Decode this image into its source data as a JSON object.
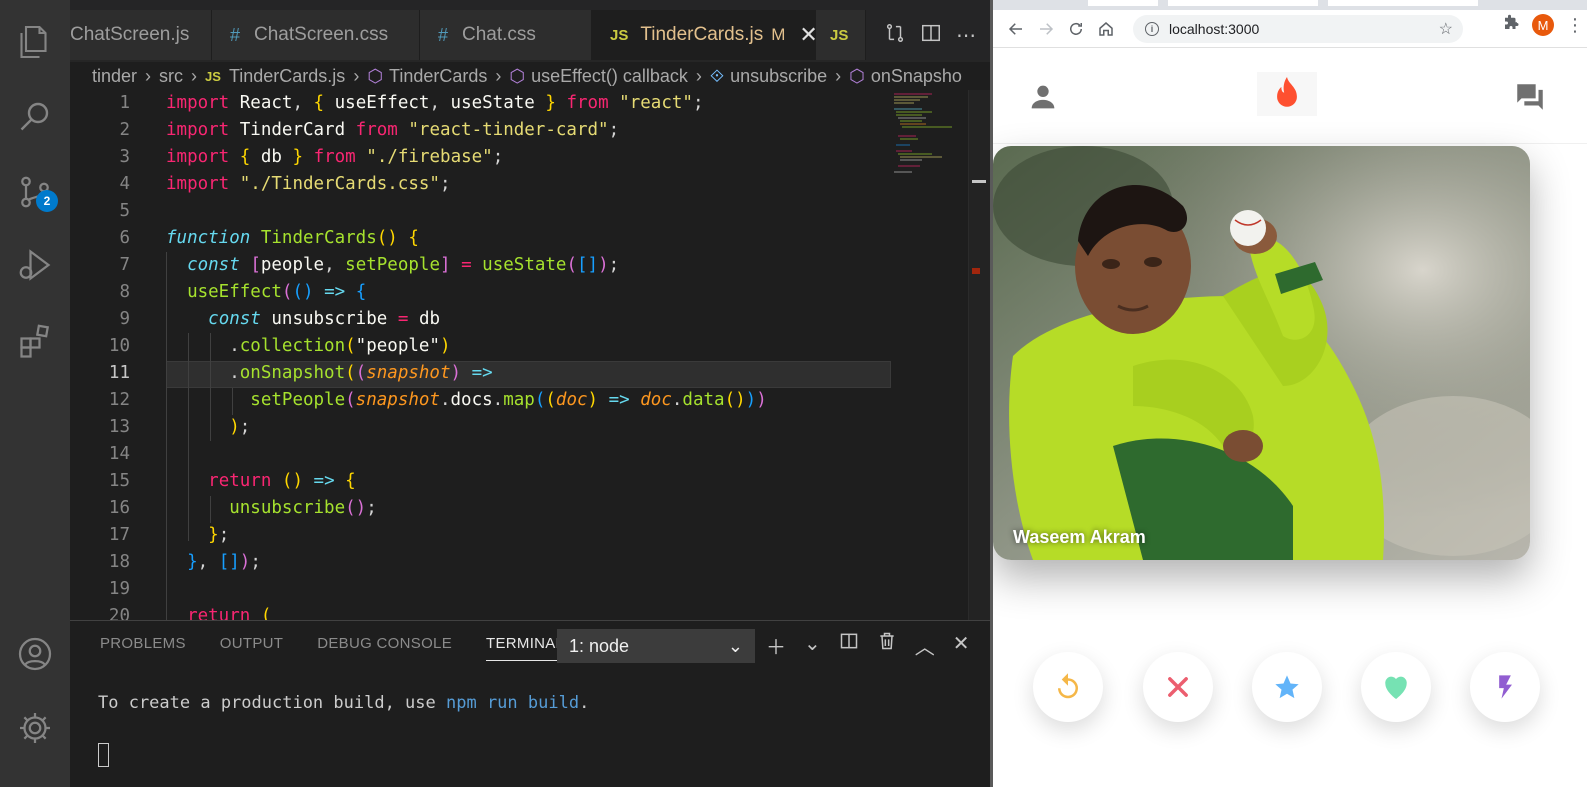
{
  "editor": {
    "tabs": [
      {
        "label": "ChatScreen.js",
        "type": "js"
      },
      {
        "label": "ChatScreen.css",
        "type": "css"
      },
      {
        "label": "Chat.css",
        "type": "css"
      },
      {
        "label": "TinderCards.js",
        "type": "js",
        "modified": "M"
      },
      {
        "label": "JS",
        "type": "js-icon"
      }
    ],
    "source_control_badge": "2",
    "breadcrumb": [
      "tinder",
      "src",
      "TinderCards.js",
      "TinderCards",
      "useEffect() callback",
      "unsubscribe",
      "onSnapsho"
    ],
    "line_numbers": [
      "1",
      "2",
      "3",
      "4",
      "5",
      "6",
      "7",
      "8",
      "9",
      "10",
      "11",
      "12",
      "13",
      "14",
      "15",
      "16",
      "17",
      "18",
      "19",
      "20"
    ],
    "current_line": "11"
  },
  "panel": {
    "tabs": [
      "PROBLEMS",
      "OUTPUT",
      "DEBUG CONSOLE",
      "TERMINAL"
    ],
    "active_tab": "TERMINAL",
    "terminal_select": "1: node",
    "terminal_line_prefix": "To create a production build, use ",
    "terminal_command": "npm run build",
    "terminal_line_suffix": "."
  },
  "browser": {
    "url": "localhost:3000",
    "profile_initial": "M",
    "card_name": "Waseem Akram",
    "buttons": [
      {
        "name": "replay",
        "color": "#f5b748"
      },
      {
        "name": "close",
        "color": "#ec5e6f"
      },
      {
        "name": "star",
        "color": "#62b4f9"
      },
      {
        "name": "favorite",
        "color": "#76e2b3"
      },
      {
        "name": "flash",
        "color": "#915dd1"
      }
    ],
    "flame_color": "#fe5030"
  }
}
